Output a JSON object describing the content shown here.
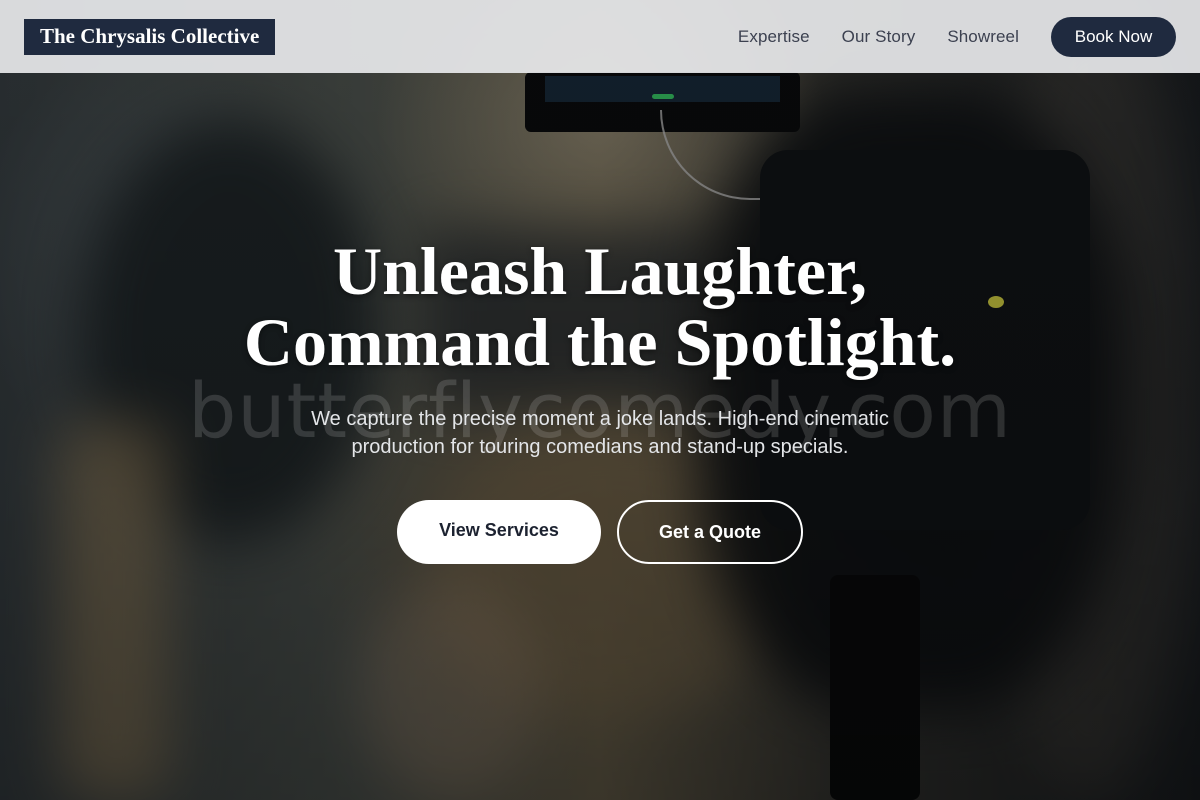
{
  "header": {
    "logo_text": "The Chrysalis Collective",
    "nav": [
      {
        "label": "Expertise"
      },
      {
        "label": "Our Story"
      },
      {
        "label": "Showreel"
      }
    ],
    "cta_label": "Book Now"
  },
  "hero": {
    "headline_line1": "Unleash Laughter,",
    "headline_line2": "Command the Spotlight.",
    "watermark": "butterflycomedy.com",
    "subhead_line1": "We capture the precise moment a joke lands. High-end cinematic",
    "subhead_line2": "production for touring comedians and stand-up specials.",
    "primary_cta": "View Services",
    "secondary_cta": "Get a Quote"
  },
  "colors": {
    "brand_navy": "#1f2a3f",
    "header_bg": "#e8e9eb",
    "nav_text": "#3c4150",
    "white": "#ffffff"
  }
}
